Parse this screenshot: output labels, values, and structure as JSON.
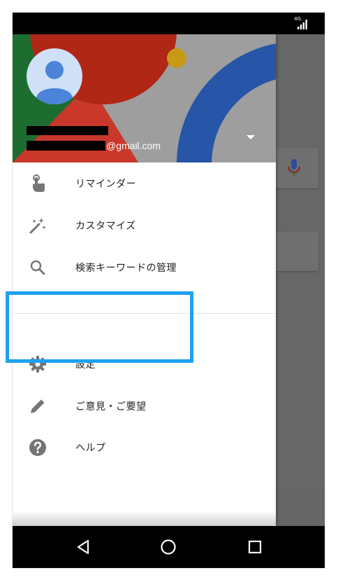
{
  "status_bar": {
    "network": "4G"
  },
  "drawer": {
    "account": {
      "email_suffix": "@gmail.com",
      "avatar": "account-avatar-icon",
      "dropdown": "dropdown-arrow-icon"
    },
    "items": [
      {
        "label": "リマインダー",
        "icon": "reminder-finger-icon"
      },
      {
        "label": "カスタマイズ",
        "icon": "magic-wand-icon"
      },
      {
        "label": "検索キーワードの管理",
        "icon": "search-icon"
      },
      {
        "label": "設定",
        "icon": "gear-icon"
      },
      {
        "label": "ご意見・ご要望",
        "icon": "pencil-icon"
      },
      {
        "label": "ヘルプ",
        "icon": "help-icon"
      }
    ]
  },
  "nav_bar": {
    "buttons": [
      "back-icon",
      "home-icon",
      "recents-icon"
    ]
  },
  "colors": {
    "highlight": "#1ea1f1",
    "header_green": "#1d6d30",
    "header_red": "#b02716",
    "header_blue": "#2755a7",
    "header_yellow": "#c79a16",
    "header_gray": "#9e9e9e"
  }
}
